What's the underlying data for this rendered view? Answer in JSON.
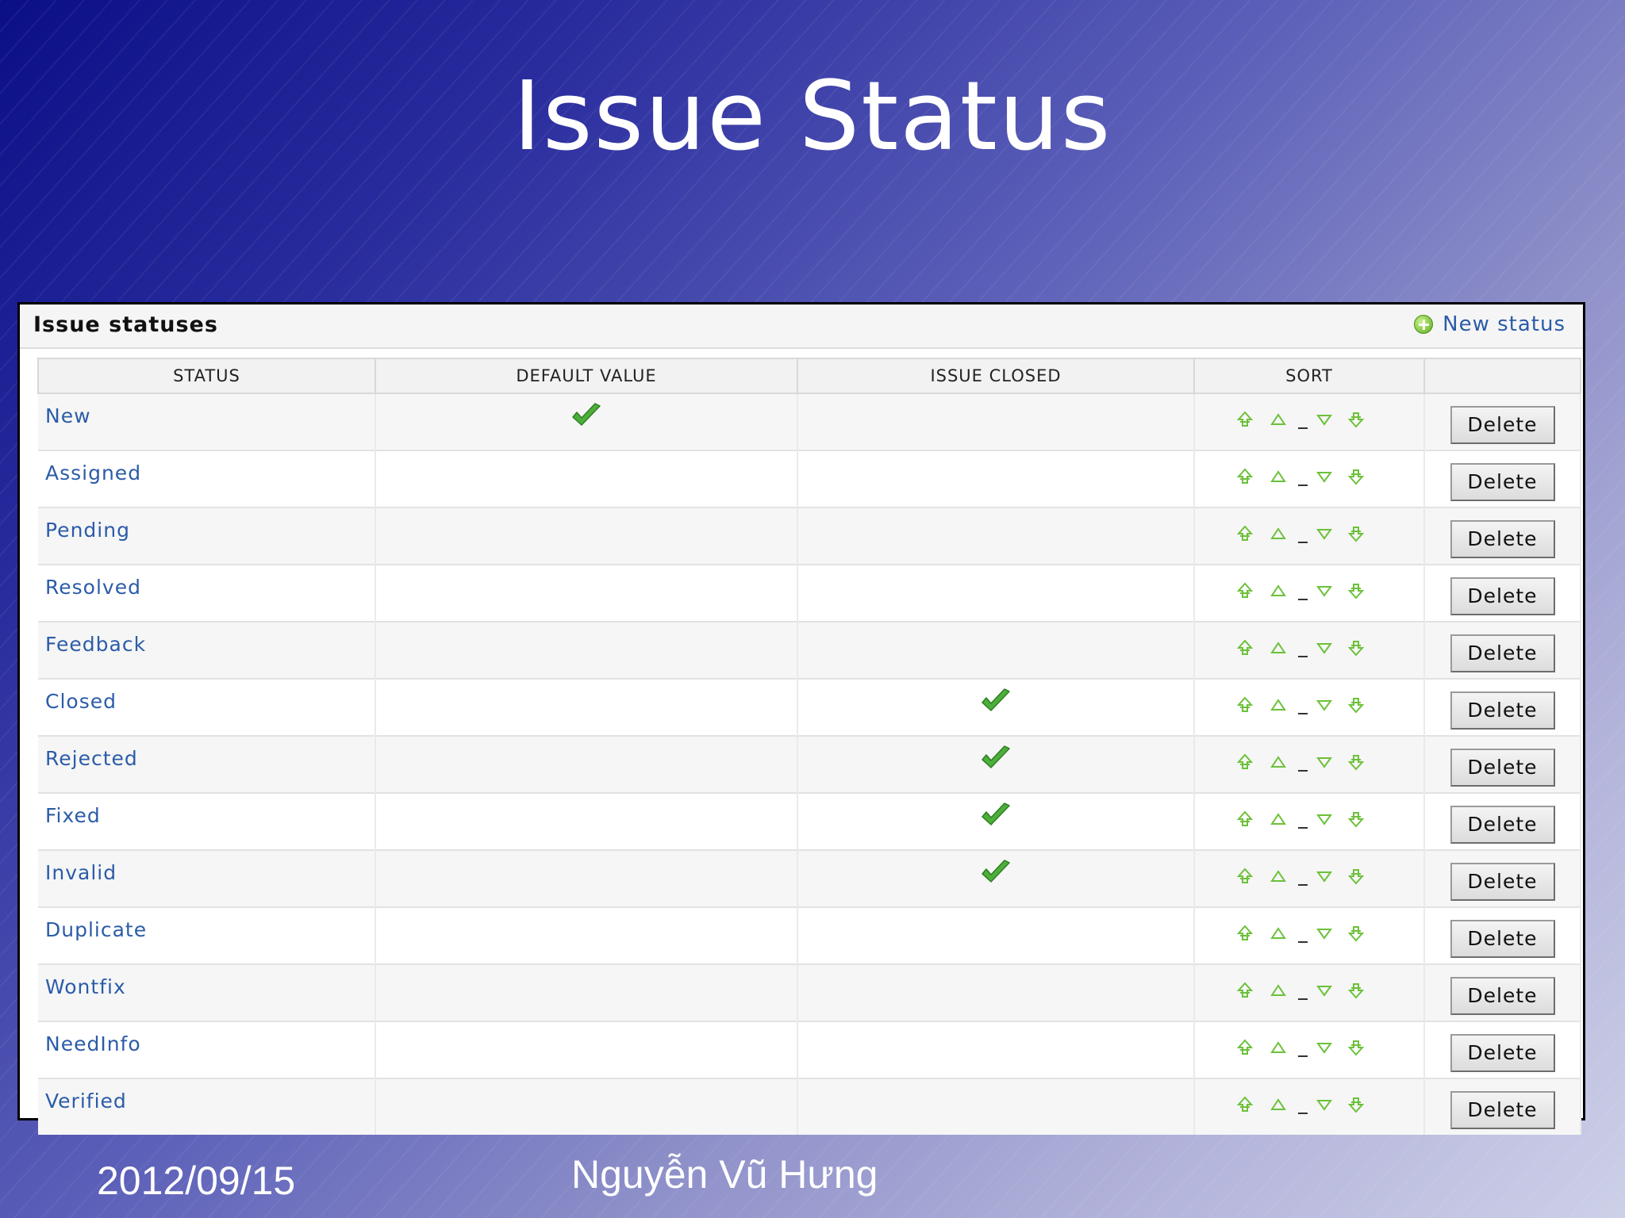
{
  "slide": {
    "title": "Issue Status",
    "footer_date": "2012/09/15",
    "footer_author": "Nguyễn Vũ Hưng"
  },
  "panel": {
    "title": "Issue statuses",
    "new_status_label": "New status"
  },
  "table": {
    "columns": [
      "STATUS",
      "DEFAULT VALUE",
      "ISSUE CLOSED",
      "SORT",
      ""
    ],
    "rows": [
      {
        "name": "New",
        "default": true,
        "closed": false
      },
      {
        "name": "Assigned",
        "default": false,
        "closed": false
      },
      {
        "name": "Pending",
        "default": false,
        "closed": false
      },
      {
        "name": "Resolved",
        "default": false,
        "closed": false
      },
      {
        "name": "Feedback",
        "default": false,
        "closed": false
      },
      {
        "name": "Closed",
        "default": false,
        "closed": true
      },
      {
        "name": "Rejected",
        "default": false,
        "closed": true
      },
      {
        "name": "Fixed",
        "default": false,
        "closed": true
      },
      {
        "name": "Invalid",
        "default": false,
        "closed": true
      },
      {
        "name": "Duplicate",
        "default": false,
        "closed": false
      },
      {
        "name": "Wontfix",
        "default": false,
        "closed": false
      },
      {
        "name": "NeedInfo",
        "default": false,
        "closed": false
      },
      {
        "name": "Verified",
        "default": false,
        "closed": false
      }
    ],
    "delete_label": "Delete",
    "sort_icons": [
      "move-top-icon",
      "move-up-icon",
      "move-down-icon",
      "move-bottom-icon"
    ]
  },
  "colors": {
    "link": "#2b5ca8",
    "check": "#4caf3a",
    "sort_icon": "#6cc13a"
  }
}
